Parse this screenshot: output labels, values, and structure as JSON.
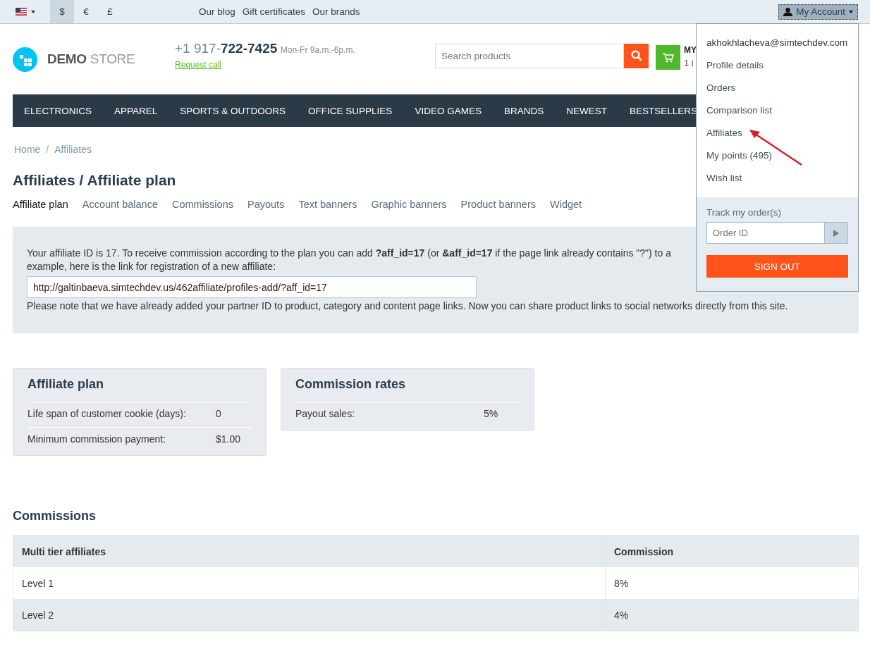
{
  "top_bar": {
    "currencies": [
      {
        "label": "$",
        "selected": true
      },
      {
        "label": "€",
        "selected": false
      },
      {
        "label": "£",
        "selected": false
      }
    ],
    "links": [
      "Our blog",
      "Gift certificates",
      "Our brands"
    ],
    "account_button": "My Account"
  },
  "header": {
    "logo": {
      "bold": "DEMO",
      "light": "STORE"
    },
    "phone": {
      "prefix": "+1 917-",
      "number": "722-7425",
      "hours": "Mon-Fr 9a.m.-6p.m."
    },
    "request_call": "Request call",
    "search": {
      "placeholder": "Search products"
    },
    "cart": {
      "title": "MY",
      "subtitle": "1 i"
    }
  },
  "nav": [
    "ELECTRONICS",
    "APPAREL",
    "SPORTS & OUTDOORS",
    "OFFICE SUPPLIES",
    "VIDEO GAMES",
    "BRANDS",
    "NEWEST",
    "BESTSELLERS"
  ],
  "breadcrumb": {
    "items": [
      "Home",
      "Affiliates"
    ],
    "separator": "/"
  },
  "page_title": "Affiliates / Affiliate plan",
  "tabs": [
    {
      "label": "Affiliate plan",
      "selected": true
    },
    {
      "label": "Account balance",
      "selected": false
    },
    {
      "label": "Commissions",
      "selected": false
    },
    {
      "label": "Payouts",
      "selected": false
    },
    {
      "label": "Text banners",
      "selected": false
    },
    {
      "label": "Graphic banners",
      "selected": false
    },
    {
      "label": "Product banners",
      "selected": false
    },
    {
      "label": "Widget",
      "selected": false
    }
  ],
  "info": {
    "text": "Your affiliate ID is 17. To receive commission according to the plan you can add **?aff_id=17** (or **&aff_id=17** if the page link already contains \"?\") to a\nexample, here is the link for registration of a new affiliate:",
    "link_value": "http://galtinbaeva.simtechdev.us/462affiliate/profiles-add/?aff_id=17",
    "note": "Please note that we have already added your partner ID to product, category and content page links. Now you can share product links to social networks directly from this site."
  },
  "cards": [
    {
      "title": "Affiliate plan",
      "rows": [
        {
          "label": "Life span of customer cookie (days):",
          "value": "0"
        },
        {
          "label": "Minimum commission payment:",
          "value": "$1.00"
        }
      ]
    },
    {
      "title": "Commission rates",
      "rows": [
        {
          "label": "Payout sales:",
          "value": "5%"
        }
      ]
    }
  ],
  "commissions": {
    "title": "Commissions",
    "columns": [
      "Multi tier affiliates",
      "Commission"
    ],
    "rows": [
      [
        "Level 1",
        "8%"
      ],
      [
        "Level 2",
        "4%"
      ]
    ]
  },
  "account_menu": {
    "email": "akhokhlacheva@simtechdev.com",
    "items": [
      "Profile details",
      "Orders",
      "Comparison list",
      "Affiliates",
      "My points (495)",
      "Wish list"
    ],
    "track_label": "Track my order(s)",
    "order_placeholder": "Order ID",
    "sign_out": "SIGN OUT"
  }
}
